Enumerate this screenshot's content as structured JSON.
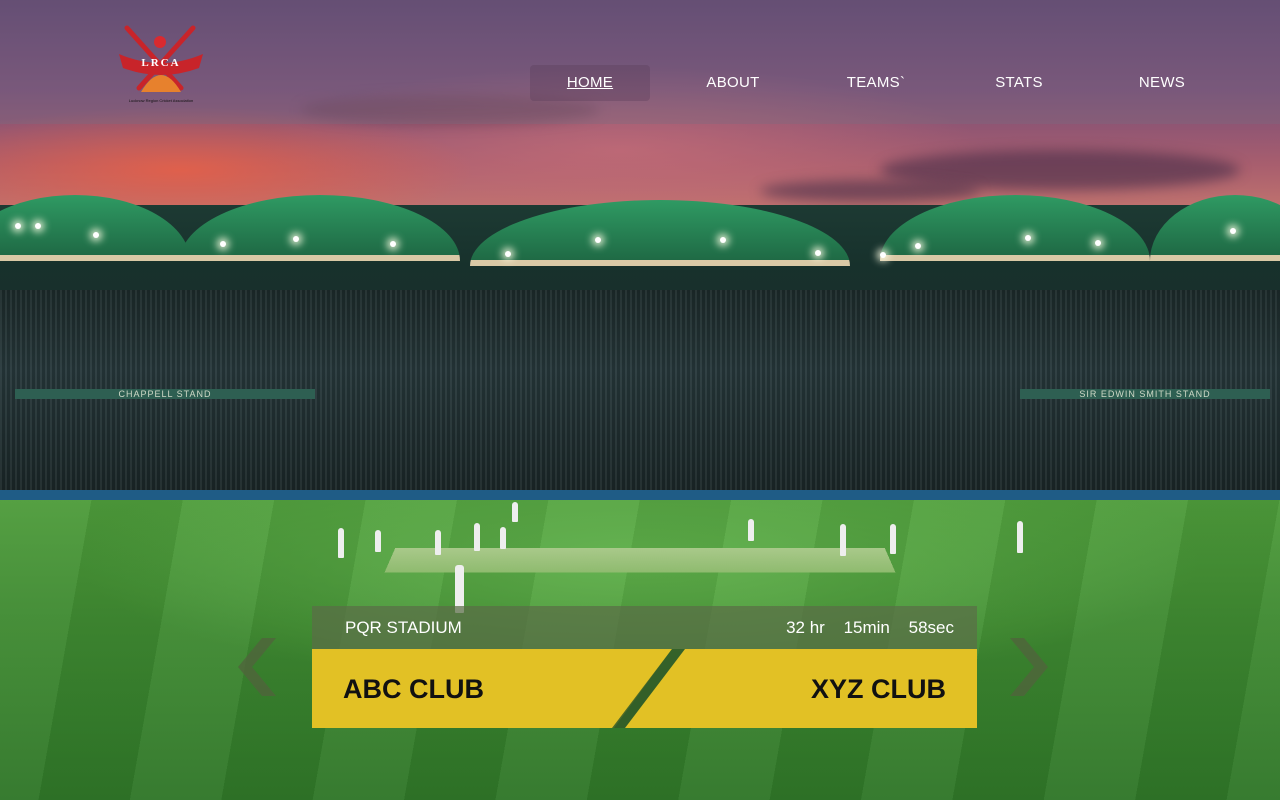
{
  "brand": {
    "logo_text": "LRCA",
    "logo_tagline": "Lucknow Region Cricket Association"
  },
  "nav": {
    "items": [
      {
        "label": "HOME"
      },
      {
        "label": "ABOUT"
      },
      {
        "label": "TEAMS`"
      },
      {
        "label": "STATS"
      },
      {
        "label": "NEWS"
      }
    ]
  },
  "stadium_signs": {
    "left": "CHAPPELL STAND",
    "right": "SIR EDWIN SMITH STAND"
  },
  "match": {
    "venue": "PQR STADIUM",
    "countdown": {
      "hours": "32 hr",
      "minutes": "15min",
      "seconds": "58sec"
    },
    "team_home": "ABC CLUB",
    "team_away": "XYZ CLUB"
  },
  "colors": {
    "accent_yellow": "#e2c125",
    "header_overlay": "#786e82"
  },
  "icons": {
    "prev": "chevron-left-icon",
    "next": "chevron-right-icon"
  }
}
